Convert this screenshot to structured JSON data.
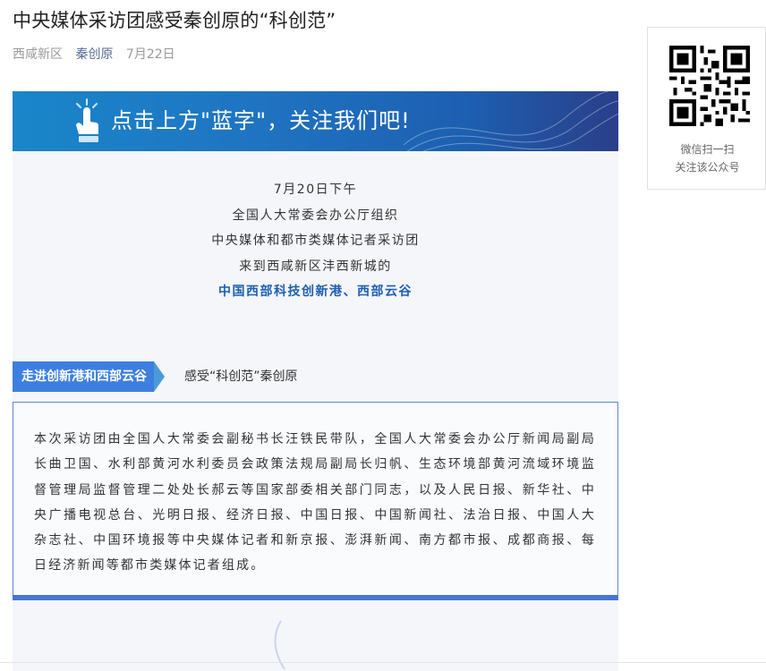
{
  "article": {
    "title": "中央媒体采访团感受秦创原的“科创范”",
    "source": "西咸新区",
    "author": "秦创原",
    "date": "7月22日"
  },
  "banner": {
    "text": "点击上方\"蓝字\"，关注我们吧!"
  },
  "intro": {
    "lines": [
      "7月20日下午",
      "全国人大常委会办公厅组织",
      "中央媒体和都市类媒体记者采访团",
      "来到西咸新区沣西新城的"
    ],
    "highlight": "中国西部科技创新港、西部云谷"
  },
  "section": {
    "tag": "走进创新港和西部云谷",
    "subtitle": "感受“科创范”秦创原"
  },
  "body_text": "本次采访团由全国人大常委会副秘书长汪铁民带队，全国人大常委会办公厅新闻局副局长曲卫国、水利部黄河水利委员会政策法规局副局长归帆、生态环境部黄河流域环境监督管理局监督管理二处处长郝云等国家部委相关部门同志，以及人民日报、新华社、中央广播电视总台、光明日报、经济日报、中国日报、中国新闻社、法治日报、中国人大杂志社、中国环境报等中央媒体记者和新京报、澎湃新闻、南方都市报、成都商报、每日经济新闻等都市类媒体记者组成。",
  "qr_card": {
    "caption_line1": "微信扫一扫",
    "caption_line2": "关注该公众号",
    "icon": "qr-code-icon"
  },
  "colors": {
    "accent_blue": "#1d5fb0",
    "tag_blue": "#3d7fe0",
    "link": "#576b95"
  }
}
